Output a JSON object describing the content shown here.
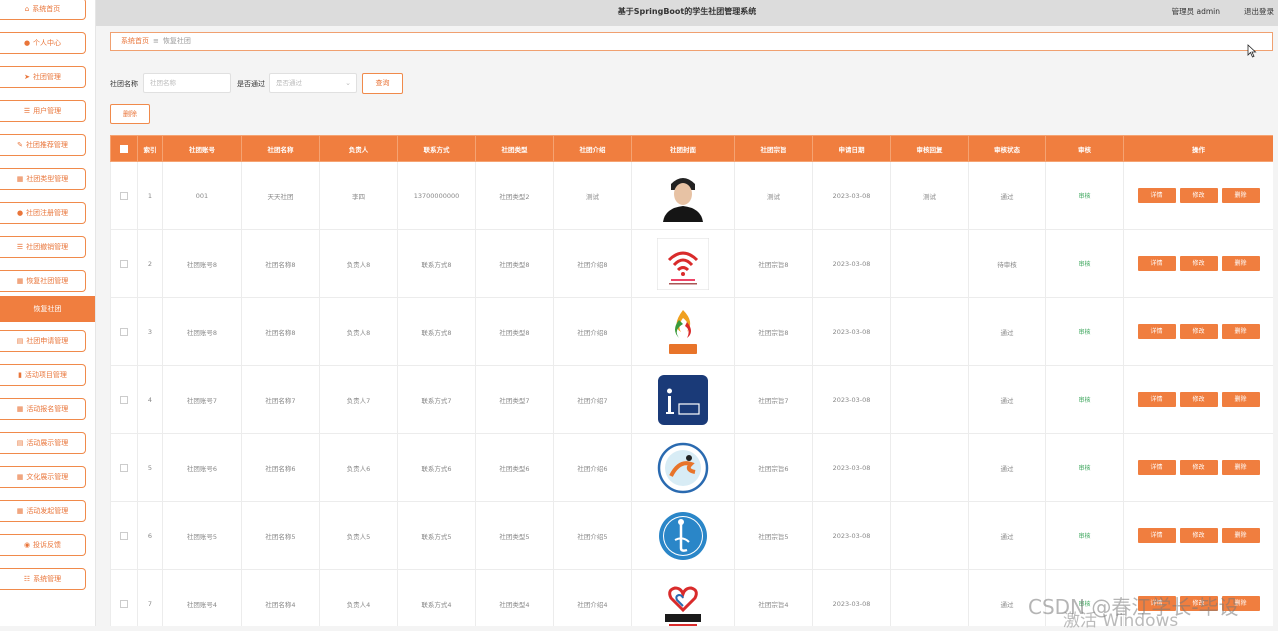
{
  "header": {
    "title": "基于SpringBoot的学生社团管理系统",
    "user": "管理员 admin",
    "logout": "退出登录"
  },
  "sidebar": {
    "items": [
      {
        "label": "系统首页",
        "icon": "home-icon",
        "glyph": "⌂"
      },
      {
        "label": "个人中心",
        "icon": "user-icon",
        "glyph": "●"
      },
      {
        "label": "社团管理",
        "icon": "send-icon",
        "glyph": "➤"
      },
      {
        "label": "用户管理",
        "icon": "list-icon",
        "glyph": "☰"
      },
      {
        "label": "社团推荐管理",
        "icon": "pencil-icon",
        "glyph": "✎"
      },
      {
        "label": "社团类型管理",
        "icon": "grid-icon",
        "glyph": "▦"
      },
      {
        "label": "社团注册管理",
        "icon": "user-icon",
        "glyph": "●"
      },
      {
        "label": "社团撤销管理",
        "icon": "list-icon",
        "glyph": "☰"
      },
      {
        "label": "恢复社团管理",
        "icon": "grid-icon",
        "glyph": "▦"
      },
      {
        "label": "恢复社团",
        "icon": "",
        "glyph": "",
        "active": true
      },
      {
        "label": "社团申请管理",
        "icon": "file-icon",
        "glyph": "▤"
      },
      {
        "label": "活动项目管理",
        "icon": "bar-chart-icon",
        "glyph": "▮"
      },
      {
        "label": "活动报名管理",
        "icon": "grid-icon",
        "glyph": "▦"
      },
      {
        "label": "活动展示管理",
        "icon": "file-icon",
        "glyph": "▤"
      },
      {
        "label": "文化展示管理",
        "icon": "grid-icon",
        "glyph": "▦"
      },
      {
        "label": "活动发起管理",
        "icon": "grid-icon",
        "glyph": "▦"
      },
      {
        "label": "投诉反馈",
        "icon": "location-icon",
        "glyph": "◉"
      },
      {
        "label": "系统管理",
        "icon": "settings-icon",
        "glyph": "☷"
      }
    ]
  },
  "breadcrumb": {
    "home": "系统首页",
    "separator": "≡",
    "current": "恢复社团"
  },
  "search": {
    "name_label": "社团名称",
    "name_placeholder": "社团名称",
    "pass_label": "是否通过",
    "pass_placeholder": "是否通过",
    "button": "查询"
  },
  "toolbar": {
    "delete_label": "删除"
  },
  "table": {
    "columns": [
      "索引",
      "社团账号",
      "社团名称",
      "负责人",
      "联系方式",
      "社团类型",
      "社团介绍",
      "社团封面",
      "社团宗旨",
      "申请日期",
      "审核回复",
      "审核状态",
      "审核",
      "操作"
    ],
    "audit_label": "审核",
    "actions": [
      "详情",
      "修改",
      "删除"
    ],
    "rows": [
      {
        "index": "1",
        "account": "001",
        "name": "天天社团",
        "leader": "李四",
        "contact": "13700000000",
        "type": "社团类型2",
        "intro": "测试",
        "cover": "portrait",
        "purpose": "测试",
        "date": "2023-03-08",
        "reply": "测试",
        "status": "通过"
      },
      {
        "index": "2",
        "account": "社团账号8",
        "name": "社团名称8",
        "leader": "负责人8",
        "contact": "联系方式8",
        "type": "社团类型8",
        "intro": "社团介绍8",
        "cover": "wifi-logo",
        "purpose": "社团宗旨8",
        "date": "2023-03-08",
        "reply": "",
        "status": "待审核"
      },
      {
        "index": "3",
        "account": "社团账号8",
        "name": "社团名称8",
        "leader": "负责人8",
        "contact": "联系方式8",
        "type": "社团类型8",
        "intro": "社团介绍8",
        "cover": "flame-logo",
        "purpose": "社团宗旨8",
        "date": "2023-03-08",
        "reply": "",
        "status": "通过"
      },
      {
        "index": "4",
        "account": "社团账号7",
        "name": "社团名称7",
        "leader": "负责人7",
        "contact": "联系方式7",
        "type": "社团类型7",
        "intro": "社团介绍7",
        "cover": "i-logo",
        "purpose": "社团宗旨7",
        "date": "2023-03-08",
        "reply": "",
        "status": "通过"
      },
      {
        "index": "5",
        "account": "社团账号6",
        "name": "社团名称6",
        "leader": "负责人6",
        "contact": "联系方式6",
        "type": "社团类型6",
        "intro": "社团介绍6",
        "cover": "circle-logo",
        "purpose": "社团宗旨6",
        "date": "2023-03-08",
        "reply": "",
        "status": "通过"
      },
      {
        "index": "6",
        "account": "社团账号5",
        "name": "社团名称5",
        "leader": "负责人5",
        "contact": "联系方式5",
        "type": "社团类型5",
        "intro": "社团介绍5",
        "cover": "blue-circle-logo",
        "purpose": "社团宗旨5",
        "date": "2023-03-08",
        "reply": "",
        "status": "通过"
      },
      {
        "index": "7",
        "account": "社团账号4",
        "name": "社团名称4",
        "leader": "负责人4",
        "contact": "联系方式4",
        "type": "社团类型4",
        "intro": "社团介绍4",
        "cover": "heart-logo",
        "purpose": "社团宗旨4",
        "date": "2023-03-08",
        "reply": "",
        "status": "通过"
      }
    ]
  },
  "watermark": {
    "csdn": "CSDN @春江学长-毕设",
    "windows": "激活 Windows"
  },
  "colors": {
    "accent": "#f07e3f",
    "audit": "#3aa55a",
    "header_bg": "#dcdcdc"
  }
}
